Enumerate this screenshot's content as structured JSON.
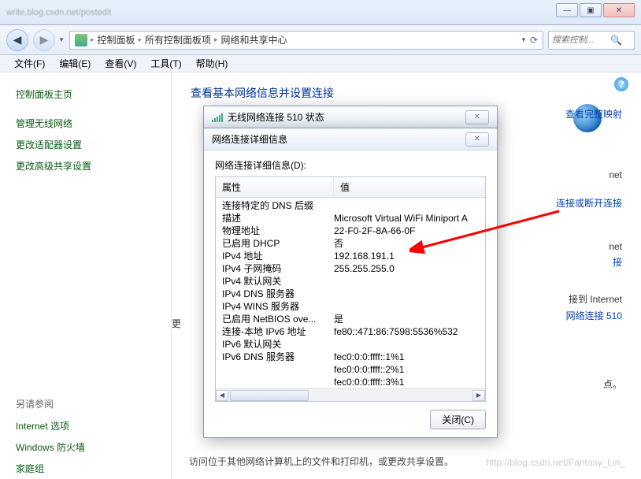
{
  "browser": {
    "url_dim": "write.blog.csdn.net/postedit"
  },
  "window_controls": {
    "min": "—",
    "max": "▣",
    "close": "✕"
  },
  "nav": {
    "back": "◀",
    "fwd": "▶",
    "breadcrumb": [
      "控制面板",
      "所有控制面板项",
      "网络和共享中心"
    ],
    "search_placeholder": "搜索控制...",
    "search_icon": "🔍",
    "refresh": "⟳"
  },
  "menubar": [
    "文件(F)",
    "编辑(E)",
    "查看(V)",
    "工具(T)",
    "帮助(H)"
  ],
  "sidebar": {
    "home": "控制面板主页",
    "items": [
      "管理无线网络",
      "更改适配器设置",
      "更改高级共享设置"
    ],
    "see_also_title": "另请参阅",
    "see_also": [
      "Internet 选项",
      "Windows 防火墙",
      "家庭组"
    ]
  },
  "content": {
    "title": "查看基本网络信息并设置连接",
    "help": "?",
    "right_links": {
      "full_map": "查看完整映射",
      "net": "net",
      "connect_disconnect": "连接或断开连接",
      "net2": "net",
      "extra": "接",
      "to_internet": "接到 Internet",
      "wifi_name": "网络连接 510",
      "dot": "点。"
    },
    "partial": "更"
  },
  "bottom_text": "访问位于其他网络计算机上的文件和打印机，或更改共享设置。",
  "watermark": "http://blog.csdn.net/Fantasy_Lin_",
  "dialog1": {
    "title": "无线网络连接 510 状态",
    "close": "✕"
  },
  "dialog2": {
    "title": "网络连接详细信息",
    "close": "✕",
    "body_label": "网络连接详细信息(D):",
    "col_prop": "属性",
    "col_val": "值",
    "rows": [
      {
        "p": "连接特定的 DNS 后缀",
        "v": ""
      },
      {
        "p": "描述",
        "v": "Microsoft Virtual WiFi Miniport A"
      },
      {
        "p": "物理地址",
        "v": "22-F0-2F-8A-66-0F"
      },
      {
        "p": "已启用 DHCP",
        "v": "否"
      },
      {
        "p": "IPv4 地址",
        "v": "192.168.191.1"
      },
      {
        "p": "IPv4 子网掩码",
        "v": "255.255.255.0"
      },
      {
        "p": "IPv4 默认网关",
        "v": ""
      },
      {
        "p": "IPv4 DNS 服务器",
        "v": ""
      },
      {
        "p": "IPv4 WINS 服务器",
        "v": ""
      },
      {
        "p": "已启用 NetBIOS ove...",
        "v": "是"
      },
      {
        "p": "连接-本地 IPv6 地址",
        "v": "fe80::471:86:7598:5536%532"
      },
      {
        "p": "IPv6 默认网关",
        "v": ""
      },
      {
        "p": "IPv6 DNS 服务器",
        "v": "fec0:0:0:ffff::1%1"
      },
      {
        "p": "",
        "v": "fec0:0:0:ffff::2%1"
      },
      {
        "p": "",
        "v": "fec0:0:0:ffff::3%1"
      }
    ],
    "close_btn": "关闭(C)"
  }
}
